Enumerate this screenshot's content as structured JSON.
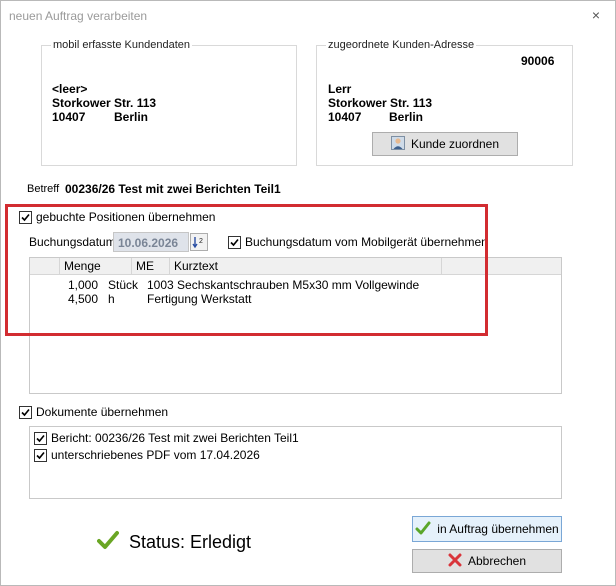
{
  "window": {
    "title": "neuen Auftrag verarbeiten",
    "close_glyph": "×"
  },
  "mobile_data": {
    "legend": "mobil erfasste Kundendaten",
    "name": "<leer>",
    "street": "Storkower Str. 113",
    "zip": "10407",
    "city": "Berlin"
  },
  "assigned_address": {
    "legend": "zugeordnete Kunden-Adresse",
    "customer_number": "90006",
    "name": "Lerr",
    "street": "Storkower Str. 113",
    "zip": "10407",
    "city": "Berlin",
    "assign_button": "Kunde zuordnen"
  },
  "subject": {
    "label": "Betreff",
    "value": "00236/26 Test mit zwei Berichten  Teil1"
  },
  "positions": {
    "checkbox_label": "gebuchte Positionen übernehmen",
    "checked": true,
    "booking_date_label": "Buchungsdatum",
    "booking_date": "10.06.2026",
    "mobile_date_checkbox_label": "Buchungsdatum vom Mobilgerät übernehmen",
    "mobile_date_checked": true,
    "columns": [
      "Menge",
      "ME",
      "Kurztext"
    ],
    "rows": [
      {
        "qty": "1,000",
        "unit": "Stück",
        "text": "1003 Sechskantschrauben M5x30 mm Vollgewinde"
      },
      {
        "qty": "4,500",
        "unit": "h",
        "text": "Fertigung Werkstatt"
      }
    ]
  },
  "documents": {
    "checkbox_label": "Dokumente übernehmen",
    "checked": true,
    "items": [
      {
        "label": "Bericht: 00236/26 Test mit zwei Berichten  Teil1",
        "checked": true
      },
      {
        "label": "unterschriebenes PDF vom 17.04.2026",
        "checked": true
      }
    ]
  },
  "status": {
    "text": "Status: Erledigt",
    "color": "#6aa624"
  },
  "buttons": {
    "accept": "in Auftrag übernehmen",
    "cancel": "Abbrechen"
  },
  "colors": {
    "highlight": "#d22c31",
    "check_green": "#5aa62a",
    "cancel_red": "#d9353b"
  }
}
